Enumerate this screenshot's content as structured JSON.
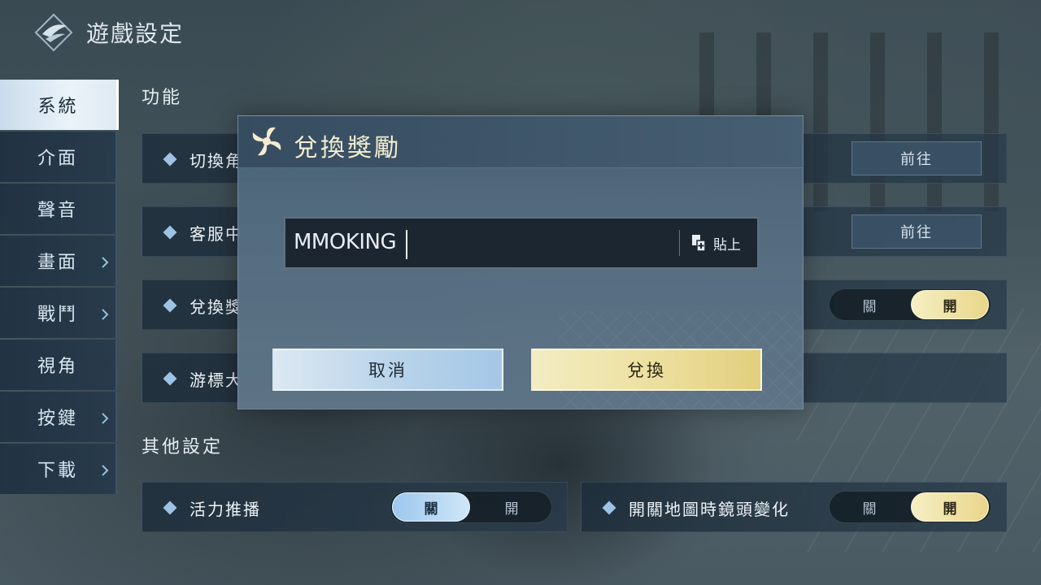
{
  "header": {
    "title": "遊戲設定",
    "logo_icon": "wing-emblem-icon"
  },
  "sidebar": {
    "items": [
      {
        "label": "系統",
        "active": true,
        "has_chevron": false
      },
      {
        "label": "介面",
        "active": false,
        "has_chevron": false
      },
      {
        "label": "聲音",
        "active": false,
        "has_chevron": false
      },
      {
        "label": "畫面",
        "active": false,
        "has_chevron": true
      },
      {
        "label": "戰鬥",
        "active": false,
        "has_chevron": true
      },
      {
        "label": "視角",
        "active": false,
        "has_chevron": false
      },
      {
        "label": "按鍵",
        "active": false,
        "has_chevron": true
      },
      {
        "label": "下載",
        "active": false,
        "has_chevron": true
      }
    ]
  },
  "sections": {
    "function_title": "功能",
    "other_title": "其他設定"
  },
  "rows": {
    "switch_role": {
      "label": "切換角",
      "button": "前往"
    },
    "customer_service": {
      "label": "客服中",
      "button": "前往"
    },
    "redeem_reward": {
      "label": "兌換獎",
      "off": "關",
      "on": "開",
      "state": "on"
    },
    "cursor_size": {
      "label": "游標大"
    },
    "vitality_push": {
      "label": "活力推播",
      "off": "關",
      "on": "開",
      "state": "off"
    },
    "map_camera": {
      "label": "開關地圖時鏡頭變化",
      "off": "關",
      "on": "開",
      "state": "on"
    }
  },
  "dialog": {
    "title": "兌換獎勵",
    "title_icon": "pinwheel-icon",
    "code_value": "MMOKING",
    "paste_label": "貼上",
    "paste_icon": "paste-icon",
    "cancel_label": "取消",
    "redeem_label": "兌換"
  }
}
